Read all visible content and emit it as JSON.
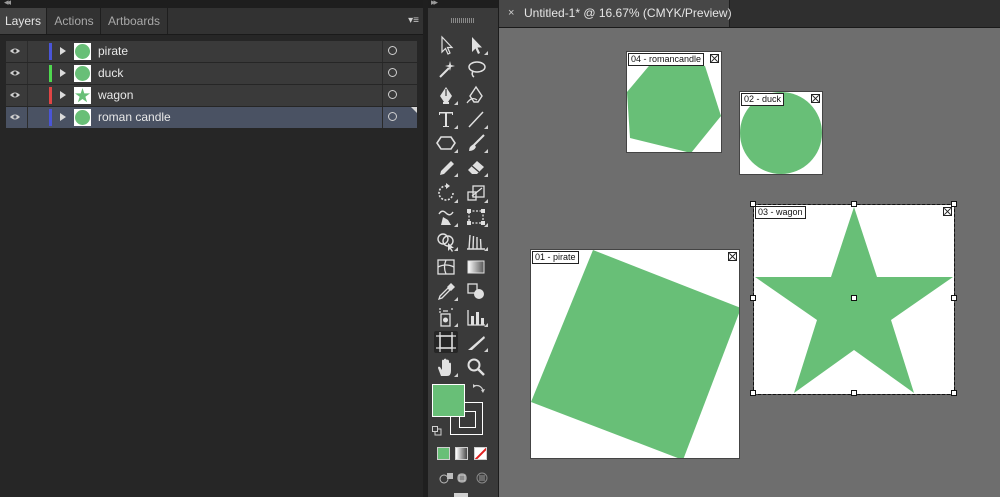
{
  "layers_panel": {
    "tabs": [
      {
        "label": "Layers",
        "active": true
      },
      {
        "label": "Actions",
        "active": false
      },
      {
        "label": "Artboards",
        "active": false
      }
    ],
    "layers": [
      {
        "name": "pirate",
        "color": "#4a55d8",
        "thumb_icon": "circle-thumbnail",
        "selected": false
      },
      {
        "name": "duck",
        "color": "#4fd84f",
        "thumb_icon": "circle-thumbnail",
        "selected": false
      },
      {
        "name": "wagon",
        "color": "#e04545",
        "thumb_icon": "star-thumbnail",
        "selected": false
      },
      {
        "name": "roman candle",
        "color": "#4a55d8",
        "thumb_icon": "circle-thumbnail",
        "selected": true
      }
    ]
  },
  "tools_panel": {
    "fill_color": "#68bf77",
    "stroke": "none"
  },
  "document": {
    "close_label": "×",
    "title": "Untitled-1* @ 16.67% (CMYK/Preview)",
    "shape_color": "#68bf77",
    "artboards": [
      {
        "label": "04 - romancandle",
        "shape": "hexagon"
      },
      {
        "label": "02 - duck",
        "shape": "circle"
      },
      {
        "label": "03 - wagon",
        "shape": "star",
        "selected": true
      },
      {
        "label": "01 - pirate",
        "shape": "rotated-square"
      }
    ]
  }
}
